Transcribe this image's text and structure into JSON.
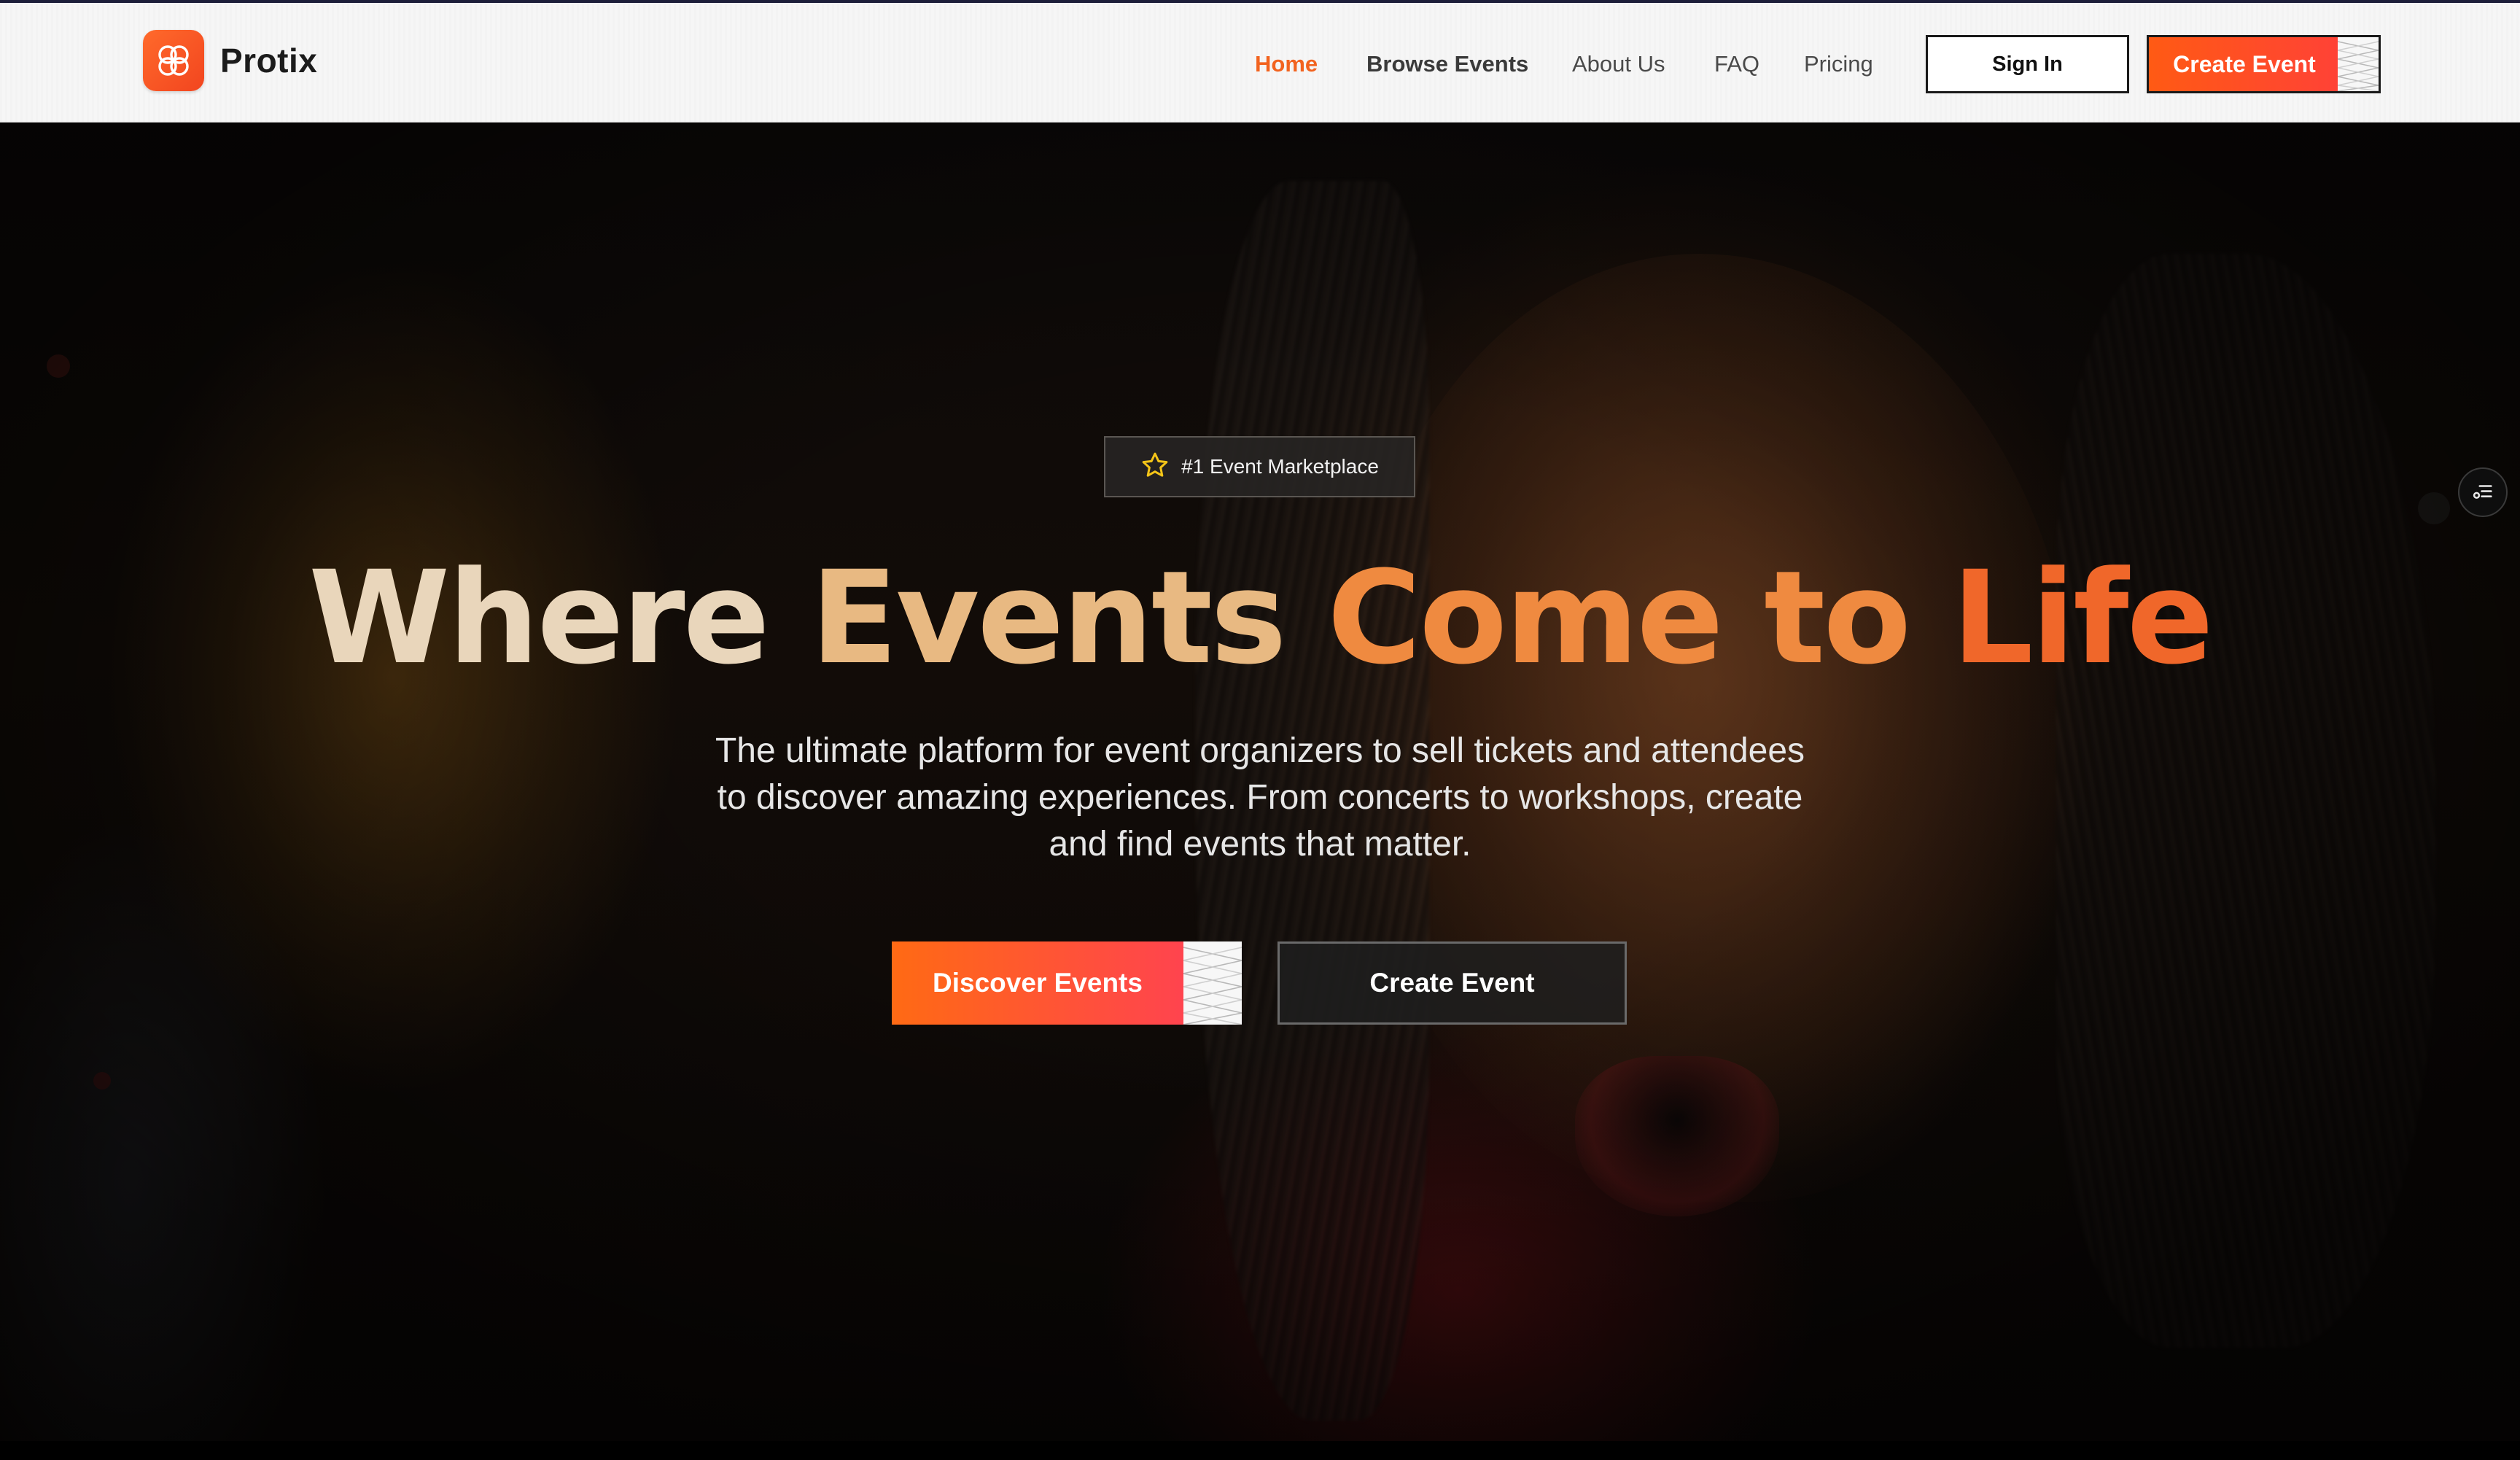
{
  "brand": {
    "name": "Protix",
    "logo_icon": "flower-logo-icon",
    "accent": "#f2631f"
  },
  "nav": {
    "items": [
      {
        "label": "Home",
        "state": "active"
      },
      {
        "label": "Browse Events",
        "state": "bold"
      },
      {
        "label": "About Us",
        "state": "normal"
      },
      {
        "label": "FAQ",
        "state": "normal"
      },
      {
        "label": "Pricing",
        "state": "normal"
      }
    ],
    "sign_in": "Sign In",
    "create_event": "Create Event"
  },
  "hero": {
    "badge": {
      "icon": "star-icon",
      "text": "#1 Event Marketplace"
    },
    "headline": {
      "part1": "Where ",
      "part2": "Events ",
      "part3": "Come to ",
      "part4": "Life"
    },
    "subtitle_lines": [
      "The ultimate platform for event organizers to sell tickets and attendees",
      "to discover amazing experiences. From concerts to workshops, create",
      "and find events that matter."
    ],
    "primary_cta": "Discover Events",
    "secondary_cta": "Create Event"
  },
  "floating": {
    "icon": "settings-list-icon"
  },
  "colors": {
    "gradient_start": "#ff6a14",
    "gradient_end": "#ff3c5a",
    "headline_light": "#e9d6bb",
    "headline_orange": "#f0672a"
  }
}
